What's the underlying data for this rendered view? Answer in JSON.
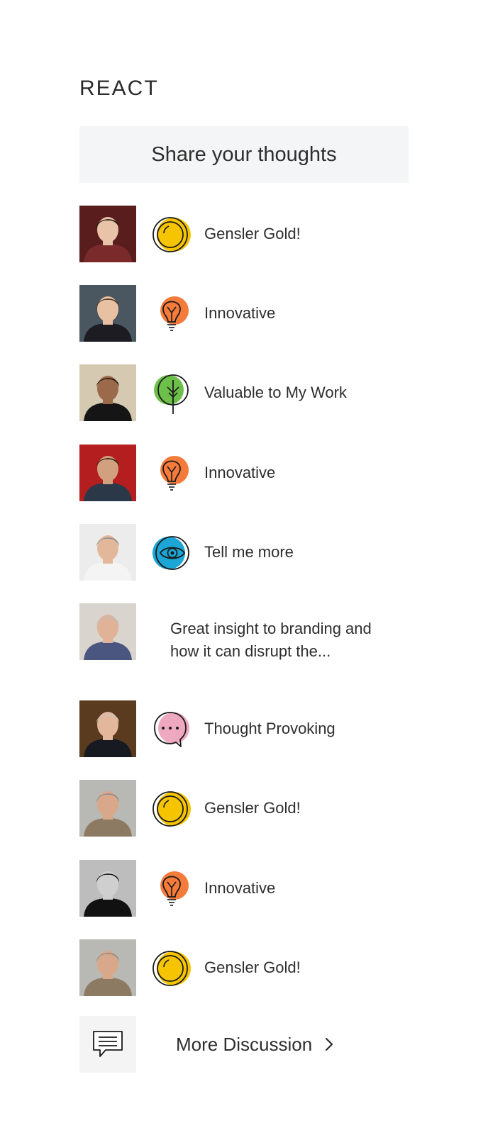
{
  "section_title": "REACT",
  "share_prompt": "Share your thoughts",
  "reactions": [
    {
      "type": "reaction",
      "icon": "gold-coin-icon",
      "label": "Gensler Gold!",
      "avatar_bg": "#5a1d1d",
      "skin": "#e8c3a8",
      "hair": "#1a1212",
      "clothes": "#7a2a2a"
    },
    {
      "type": "reaction",
      "icon": "lightbulb-icon",
      "label": "Innovative",
      "avatar_bg": "#4a5660",
      "skin": "#e8c1a2",
      "hair": "#4a3324",
      "clothes": "#1c1c22"
    },
    {
      "type": "reaction",
      "icon": "tree-icon",
      "label": "Valuable to My Work",
      "avatar_bg": "#d6c9b1",
      "skin": "#9b6a4a",
      "hair": "#1a1210",
      "clothes": "#151515"
    },
    {
      "type": "reaction",
      "icon": "lightbulb-icon",
      "label": "Innovative",
      "avatar_bg": "#b51e1e",
      "skin": "#d2a07f",
      "hair": "#2a1c14",
      "clothes": "#2b3848"
    },
    {
      "type": "reaction",
      "icon": "eye-icon",
      "label": "Tell me more",
      "avatar_bg": "#ececec",
      "skin": "#e3b79a",
      "hair": "#8e8e8e",
      "clothes": "#f4f4f4"
    },
    {
      "type": "comment",
      "text": "Great insight to branding and how it can disrupt the...",
      "avatar_bg": "#d9d4cd",
      "skin": "#e0b297",
      "hair": "#bdbdbd",
      "clothes": "#4a5680"
    },
    {
      "type": "reaction",
      "icon": "speech-bubble-icon",
      "label": "Thought Provoking",
      "avatar_bg": "#5a3b20",
      "skin": "#e2b79b",
      "hair": "#c8c8c8",
      "clothes": "#181a22"
    },
    {
      "type": "reaction",
      "icon": "gold-coin-icon",
      "label": "Gensler Gold!",
      "avatar_bg": "#b8b8b4",
      "skin": "#d9a88a",
      "hair": "#8a8a8a",
      "clothes": "#8c7a62"
    },
    {
      "type": "reaction",
      "icon": "lightbulb-icon",
      "label": "Innovative",
      "avatar_bg": "#bdbdbd",
      "skin": "#cfcfcf",
      "hair": "#1a1a1a",
      "clothes": "#111111"
    },
    {
      "type": "reaction",
      "icon": "gold-coin-icon",
      "label": "Gensler Gold!",
      "avatar_bg": "#b8b8b4",
      "skin": "#d9a88a",
      "hair": "#8a8a8a",
      "clothes": "#8c7a62"
    }
  ],
  "more_discussion": "More Discussion",
  "colors": {
    "gold": "#f6c400",
    "orange": "#f57b3b",
    "green": "#6cc04a",
    "blue": "#1ba6d6",
    "pink": "#eea8bf",
    "share_bg": "#f4f5f6"
  }
}
